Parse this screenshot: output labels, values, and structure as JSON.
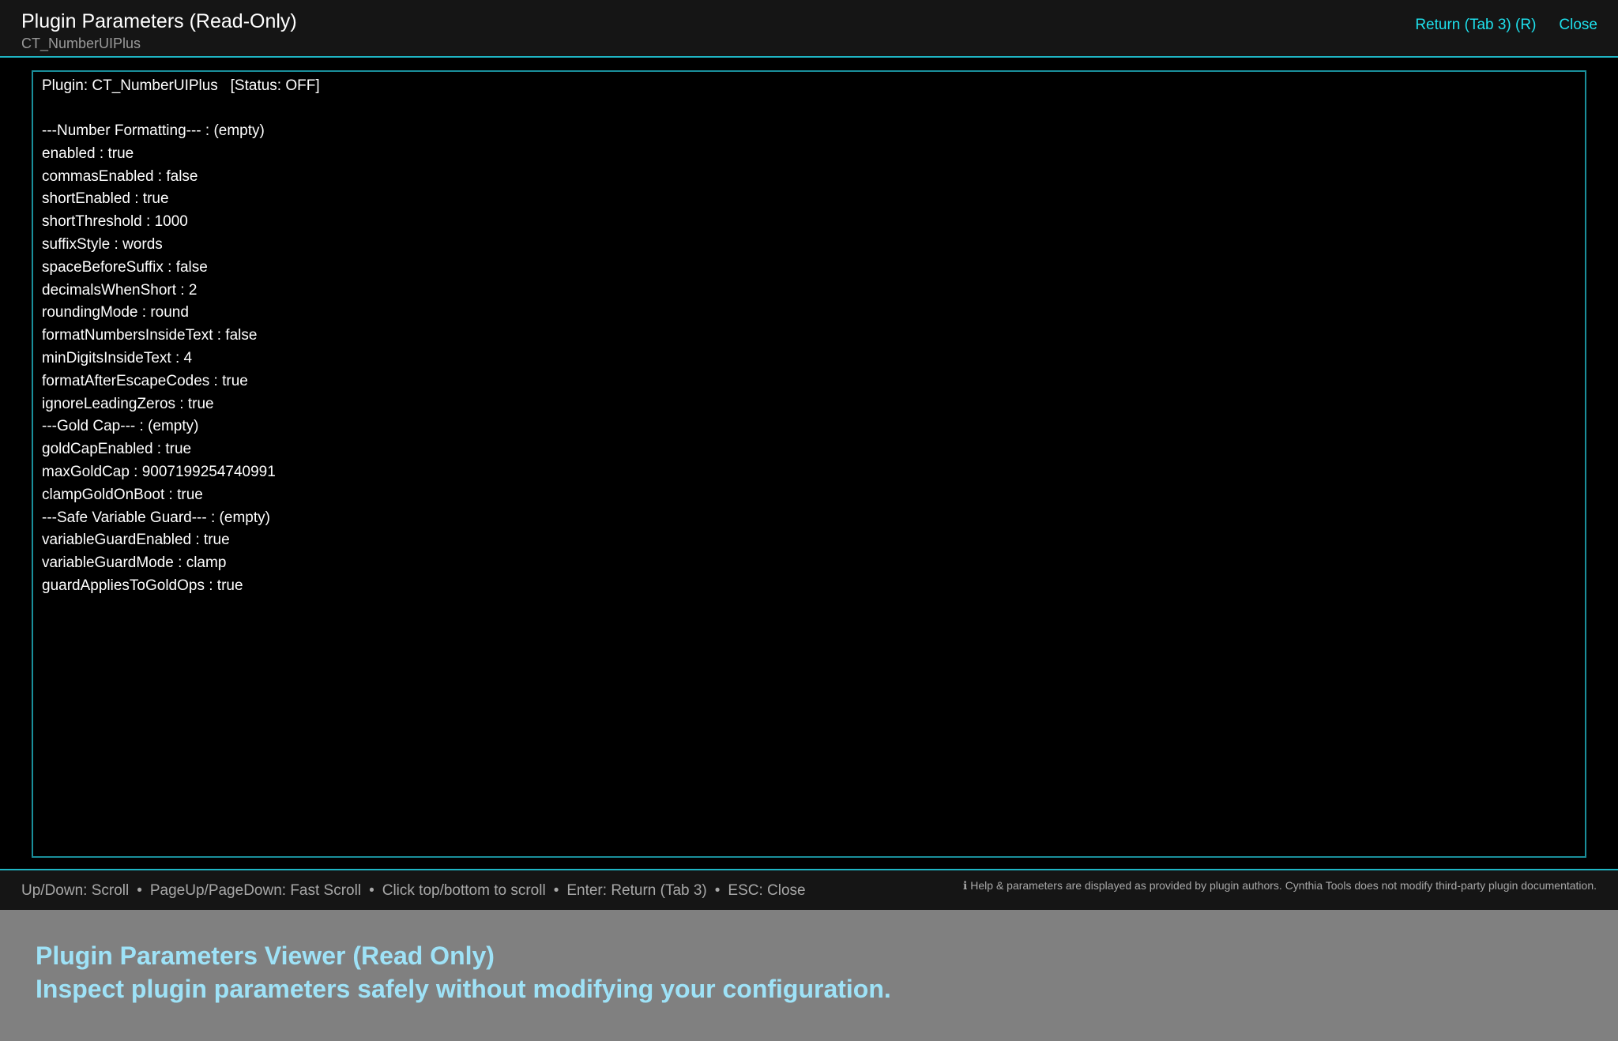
{
  "header": {
    "title": "Plugin Parameters (Read-Only)",
    "subtitle": "CT_NumberUIPlus",
    "return_label": "Return (Tab 3) (R)",
    "close_label": "Close"
  },
  "panel": {
    "plugin_line": "Plugin: CT_NumberUIPlus   [Status: OFF]",
    "lines": [
      "---Number Formatting--- : (empty)",
      "enabled : true",
      "commasEnabled : false",
      "shortEnabled : true",
      "shortThreshold : 1000",
      "suffixStyle : words",
      "spaceBeforeSuffix : false",
      "decimalsWhenShort : 2",
      "roundingMode : round",
      "formatNumbersInsideText : false",
      "minDigitsInsideText : 4",
      "formatAfterEscapeCodes : true",
      "ignoreLeadingZeros : true",
      "---Gold Cap--- : (empty)",
      "goldCapEnabled : true",
      "maxGoldCap : 9007199254740991",
      "clampGoldOnBoot : true",
      "---Safe Variable Guard--- : (empty)",
      "variableGuardEnabled : true",
      "variableGuardMode : clamp",
      "guardAppliesToGoldOps : true"
    ]
  },
  "footer": {
    "hints": [
      "Up/Down: Scroll",
      "PageUp/PageDown: Fast Scroll",
      "Click top/bottom to scroll",
      "Enter: Return (Tab 3)",
      "ESC: Close"
    ],
    "separator": "•",
    "note": "ℹ Help & parameters are displayed as provided by plugin authors. Cynthia Tools does not modify third-party plugin documentation."
  },
  "caption": {
    "line1": "Plugin Parameters Viewer (Read Only)",
    "line2": "Inspect plugin parameters safely without modifying your configuration."
  },
  "colors": {
    "accent": "#1ee0ec",
    "border": "#1a8f9b",
    "caption_text": "#9ee2f7",
    "caption_bg": "#808080"
  }
}
